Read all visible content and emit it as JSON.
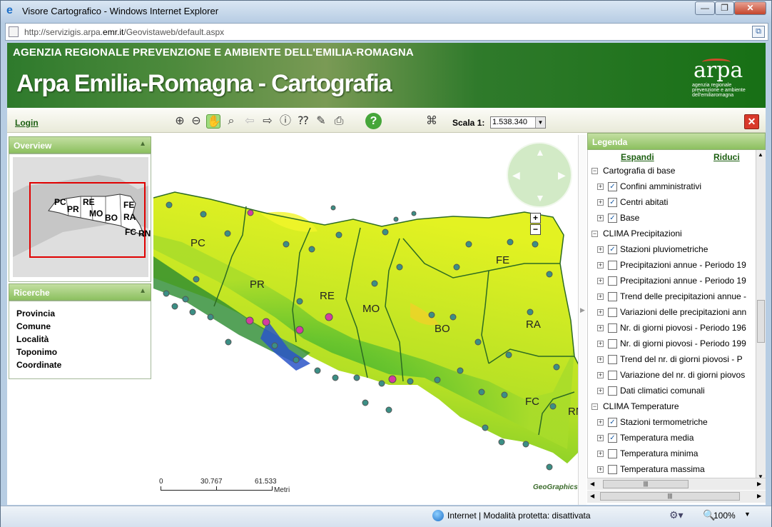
{
  "window": {
    "title": "Visore Cartografico - Windows Internet Explorer",
    "url_prefix": "http://servizigis.arpa.",
    "url_domain": "emr.it",
    "url_suffix": "/Geovistaweb/default.aspx",
    "min": "—",
    "max": "❐",
    "close": "✕"
  },
  "banner": {
    "agency": "AGENZIA REGIONALE PREVENZIONE E AMBIENTE DELL'EMILIA-ROMAGNA",
    "title": "Arpa Emilia-Romagna - Cartografia",
    "logo_word": "arpa",
    "logo_sub": "agenzia regionale prevenzione e ambiente dell'emiliaromagna"
  },
  "toolbar": {
    "login": "Login",
    "tools": [
      "zoom-in-icon",
      "zoom-out-icon",
      "pan-hand-icon",
      "zoom-window-icon",
      "back-arrow-icon",
      "forward-arrow-icon",
      "info-icon",
      "query-icon",
      "measure-icon",
      "print-icon",
      "help-icon",
      "map-legend-icon"
    ],
    "help": "?",
    "scale_label": "Scala 1:",
    "scale_value": "1.538.340",
    "close": "✕"
  },
  "overview": {
    "title": "Overview",
    "labels": [
      "PC",
      "PR",
      "RE",
      "MO",
      "BO",
      "FE",
      "RA",
      "FC",
      "RN"
    ]
  },
  "ricerche": {
    "title": "Ricerche",
    "items": [
      "Provincia",
      "Comune",
      "Località",
      "Toponimo",
      "Coordinate"
    ]
  },
  "map": {
    "provinces": [
      "PC",
      "PR",
      "RE",
      "MO",
      "BO",
      "FE",
      "RA",
      "FC",
      "RN"
    ],
    "scale_ticks": [
      "0",
      "30.767",
      "61.533"
    ],
    "scale_unit": "Metri",
    "credit": "GeoGraphics",
    "zoom_in": "+",
    "zoom_out": "−"
  },
  "legend": {
    "title": "Legenda",
    "expand": "Espandi",
    "reduce": "Riduci",
    "groups": [
      {
        "name": "Cartografia di base",
        "items": [
          {
            "label": "Confini amministrativi",
            "checked": true
          },
          {
            "label": "Centri abitati",
            "checked": true
          },
          {
            "label": "Base",
            "checked": true
          }
        ]
      },
      {
        "name": "CLIMA Precipitazioni",
        "items": [
          {
            "label": "Stazioni pluviometriche",
            "checked": true
          },
          {
            "label": "Precipitazioni annue - Periodo 19",
            "checked": false
          },
          {
            "label": "Precipitazioni annue - Periodo 19",
            "checked": false
          },
          {
            "label": "Trend delle precipitazioni annue -",
            "checked": false
          },
          {
            "label": "Variazioni delle precipitazioni ann",
            "checked": false
          },
          {
            "label": "Nr. di giorni piovosi - Periodo 196",
            "checked": false
          },
          {
            "label": "Nr. di giorni piovosi - Periodo 199",
            "checked": false
          },
          {
            "label": "Trend del nr. di giorni piovosi - P",
            "checked": false
          },
          {
            "label": "Variazione del nr. di giorni piovos",
            "checked": false
          },
          {
            "label": "Dati climatici comunali",
            "checked": false
          }
        ]
      },
      {
        "name": "CLIMA Temperature",
        "items": [
          {
            "label": "Stazioni termometriche",
            "checked": true
          },
          {
            "label": "Temperatura media",
            "checked": true
          },
          {
            "label": "Temperatura minima",
            "checked": false
          },
          {
            "label": "Temperatura massima",
            "checked": false
          }
        ]
      }
    ]
  },
  "status": {
    "zone": "Internet | Modalità protetta: disattivata",
    "zoom": "100%"
  }
}
